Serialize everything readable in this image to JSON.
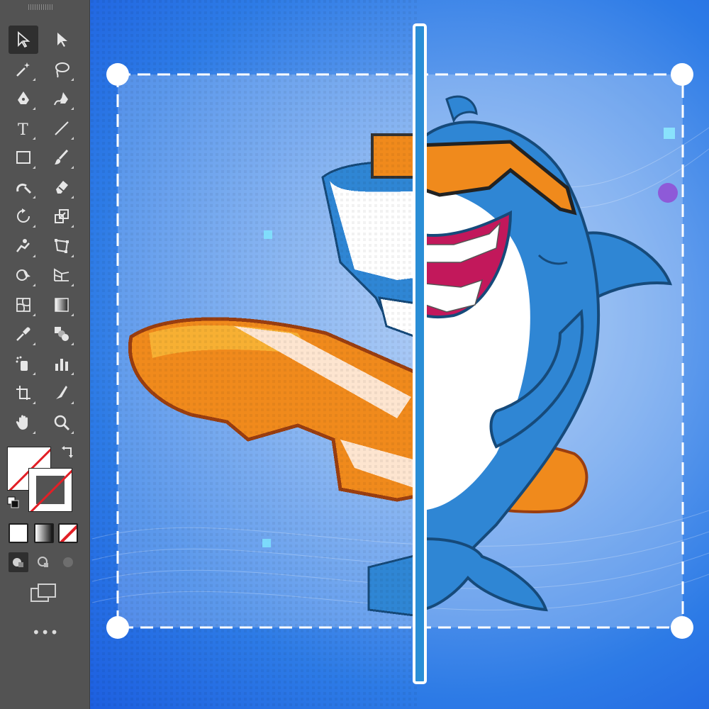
{
  "toolbar": {
    "tools": [
      {
        "name": "selection-tool",
        "icon": "arrow-outline-icon",
        "active": true
      },
      {
        "name": "direct-selection-tool",
        "icon": "arrow-filled-icon"
      },
      {
        "name": "magic-wand-tool",
        "icon": "magic-wand-icon"
      },
      {
        "name": "lasso-tool",
        "icon": "lasso-icon"
      },
      {
        "name": "pen-tool",
        "icon": "pen-icon"
      },
      {
        "name": "curvature-tool",
        "icon": "curvature-pen-icon"
      },
      {
        "name": "type-tool",
        "icon": "type-icon",
        "glyph": "T"
      },
      {
        "name": "line-segment-tool",
        "icon": "line-icon"
      },
      {
        "name": "rectangle-tool",
        "icon": "rectangle-icon"
      },
      {
        "name": "paintbrush-tool",
        "icon": "paintbrush-icon"
      },
      {
        "name": "shaper-tool",
        "icon": "shaper-icon"
      },
      {
        "name": "eraser-tool",
        "icon": "eraser-icon"
      },
      {
        "name": "rotate-tool",
        "icon": "rotate-icon"
      },
      {
        "name": "scale-tool",
        "icon": "scale-icon"
      },
      {
        "name": "puppet-warp-tool",
        "icon": "puppet-warp-icon"
      },
      {
        "name": "free-transform-tool",
        "icon": "free-transform-icon"
      },
      {
        "name": "shape-builder-tool",
        "icon": "shape-builder-icon"
      },
      {
        "name": "perspective-grid-tool",
        "icon": "perspective-grid-icon"
      },
      {
        "name": "mesh-tool",
        "icon": "mesh-icon"
      },
      {
        "name": "gradient-tool",
        "icon": "gradient-icon"
      },
      {
        "name": "eyedropper-tool",
        "icon": "eyedropper-icon"
      },
      {
        "name": "blend-tool",
        "icon": "blend-icon"
      },
      {
        "name": "symbol-sprayer-tool",
        "icon": "symbol-sprayer-icon"
      },
      {
        "name": "column-graph-tool",
        "icon": "bar-graph-icon"
      },
      {
        "name": "artboard-tool",
        "icon": "artboard-icon"
      },
      {
        "name": "slice-tool",
        "icon": "slice-icon"
      },
      {
        "name": "hand-tool",
        "icon": "hand-icon"
      },
      {
        "name": "zoom-tool",
        "icon": "magnifier-icon"
      }
    ],
    "fill_color": "#ffffff",
    "stroke_color": "none",
    "more_label": "•••"
  },
  "colors": {
    "toolbar_bg": "#535353",
    "canvas_blue": "#2d7be6",
    "selection_stroke": "#ffffff",
    "surfboard_orange": "#f08a1c",
    "shark_blue": "#2f86d4",
    "accent_red": "#e21f26"
  }
}
